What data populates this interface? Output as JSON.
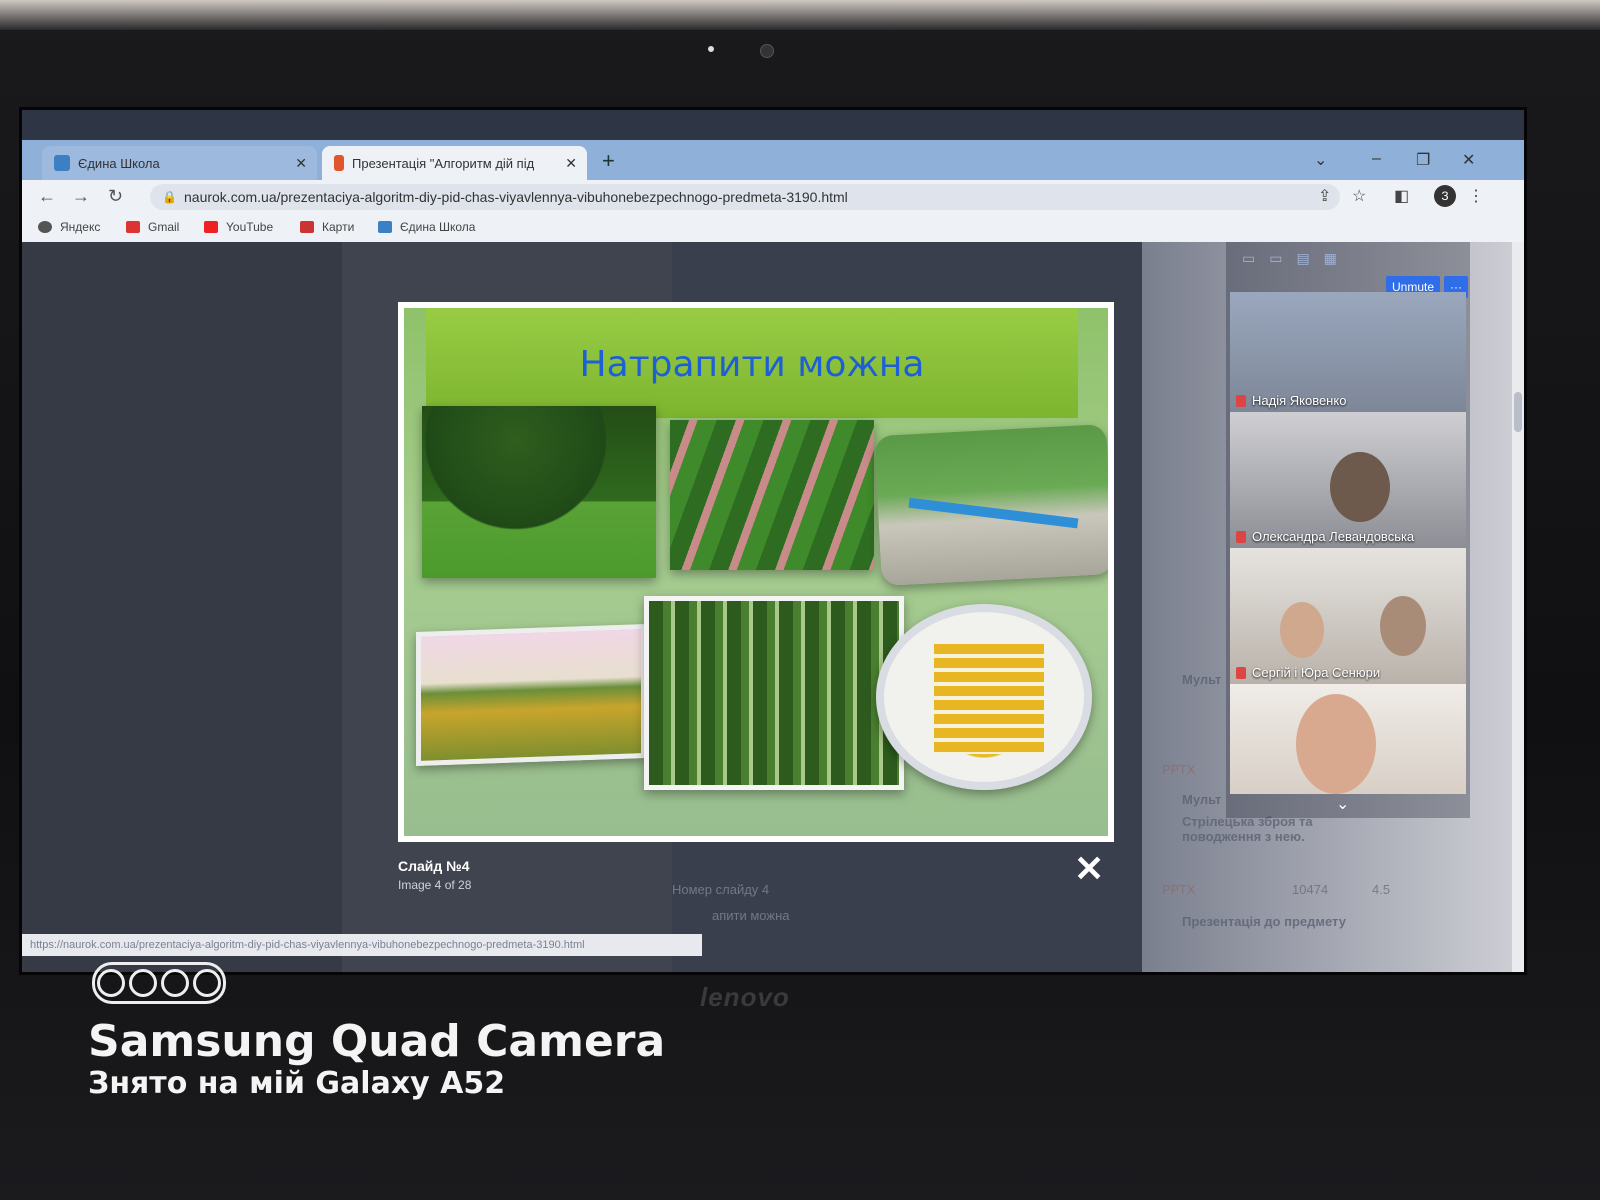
{
  "browser": {
    "tabs": [
      {
        "label": "Єдина Школа",
        "active": false
      },
      {
        "label": "Презентація \"Алгоритм дій під",
        "active": false
      }
    ],
    "url": "naurok.com.ua/prezentaciya-algoritm-diy-pid-chas-viyavlennya-vibuhonebezpechnogo-predmeta-3190.html",
    "bookmarks": [
      "Яндекс",
      "Gmail",
      "YouTube",
      "Карти",
      "Єдина Школа"
    ],
    "profile_initial": "З",
    "status_url": "https://naurok.com.ua/prezentaciya-algoritm-diy-pid-chas-viyavlennya-vibuhonebezpechnogo-predmeta-3190.html"
  },
  "lightbox": {
    "slide_title": "Натрапити можна",
    "caption": "Слайд №4",
    "counter": "Image 4 of 28",
    "close": "✕"
  },
  "page_background": {
    "slide_number_label": "Номер слайду 4",
    "slide_label_fragment": "апити можна",
    "side_text": "Стрілецька зброя та поводження з нею.",
    "side_tag": "РРТХ",
    "side_fragment_1": "Мульт",
    "side_fragment_2": "Мульт",
    "views": "10474",
    "rating": "4.5",
    "footer_fragment": "Презентація до предмету"
  },
  "meeting": {
    "unmute_label": "Unmute",
    "more_label": "···",
    "participants": [
      {
        "name": "Надія Яковенко"
      },
      {
        "name": "Олександра Левандовська"
      },
      {
        "name": "Сергій і Юра Сенюри"
      }
    ]
  },
  "device": {
    "brand": "lenovo"
  },
  "watermark": {
    "line1": "Samsung Quad Camera",
    "line2": "Знято на мій Galaxy A52"
  },
  "colors": {
    "slide_title": "#1f5fd6",
    "title_band": "#8cc43c",
    "unmute_button": "#2f6ee8",
    "mic_muted": "#dd4444"
  }
}
